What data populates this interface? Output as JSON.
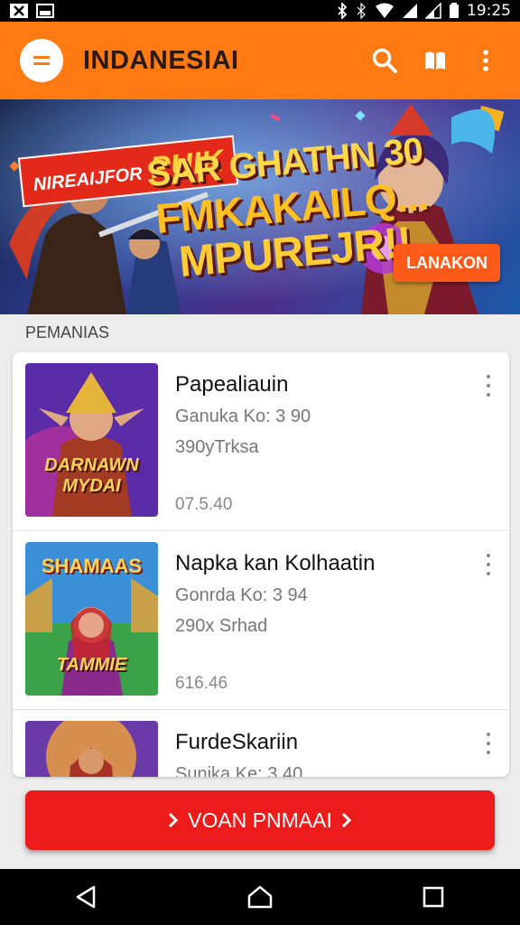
{
  "status_bar": {
    "time": "19:25",
    "left_icons": [
      "close-box-icon",
      "image-icon"
    ],
    "right_icons": [
      "bluetooth-icon",
      "vibrate-icon",
      "wifi-icon",
      "signal-icon",
      "signal-icon",
      "battery-icon"
    ]
  },
  "appbar": {
    "title": "INDANESIAI",
    "color": "#ff7a12"
  },
  "banner": {
    "tag": "NIREAIJFOR",
    "tag_big": "PUIK",
    "line1": "SAR GHATHN 30",
    "line2": "FMKAKAILQ...",
    "line3": "MPUREJR!!",
    "button": "LANAKON"
  },
  "section_title": "PEMANIAS",
  "items": [
    {
      "title": "Papealiauin",
      "sub1": "Ganuka Ko: 3 90",
      "sub2": "390yTrksa",
      "date": "07.5.40",
      "thumb_text": "DARNAWN MYDAI",
      "thumb_top": ""
    },
    {
      "title": "Napka kan Kolhaatin",
      "sub1": "Gonrda Ko: 3 94",
      "sub2": "290x Srhad",
      "date": "616.46",
      "thumb_text": "TAMMIE",
      "thumb_top": "SHAMAAS"
    },
    {
      "title": "FurdeSkariin",
      "sub1": "Sunika Ke: 3.40",
      "sub2": "",
      "date": "",
      "thumb_text": "",
      "thumb_top": ""
    }
  ],
  "cta": {
    "label": "VOAN PNMAAI",
    "color": "#ec1c1c"
  }
}
